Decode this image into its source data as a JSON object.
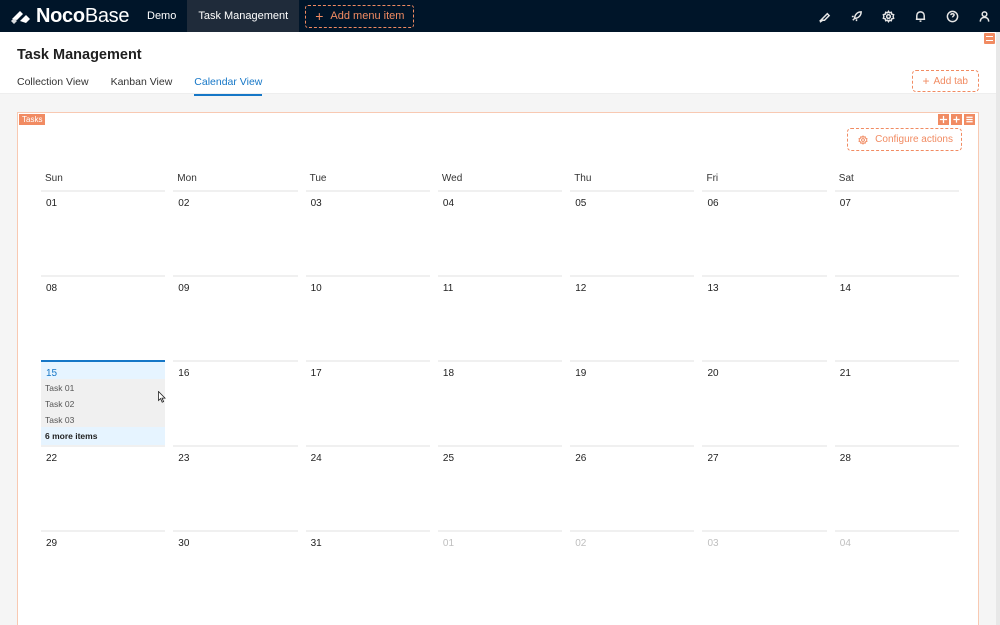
{
  "brand": {
    "bold": "Noco",
    "light": "Base"
  },
  "nav": {
    "items": [
      {
        "label": "Demo",
        "active": false
      },
      {
        "label": "Task Management",
        "active": true
      }
    ],
    "add_menu_label": "Add menu item"
  },
  "top_icons": [
    "highlighter-icon",
    "rocket-icon",
    "gear-icon",
    "bell-icon",
    "help-icon",
    "user-icon"
  ],
  "page": {
    "title": "Task Management",
    "tabs": [
      {
        "label": "Collection View",
        "active": false
      },
      {
        "label": "Kanban View",
        "active": false
      },
      {
        "label": "Calendar View",
        "active": true
      }
    ],
    "add_tab_label": "Add tab"
  },
  "block": {
    "tag": "Tasks",
    "configure_label": "Configure actions"
  },
  "calendar": {
    "weekdays": [
      "Sun",
      "Mon",
      "Tue",
      "Wed",
      "Thu",
      "Fri",
      "Sat"
    ],
    "weeks": [
      [
        {
          "d": "01"
        },
        {
          "d": "02"
        },
        {
          "d": "03"
        },
        {
          "d": "04"
        },
        {
          "d": "05"
        },
        {
          "d": "06"
        },
        {
          "d": "07"
        }
      ],
      [
        {
          "d": "08"
        },
        {
          "d": "09"
        },
        {
          "d": "10"
        },
        {
          "d": "11"
        },
        {
          "d": "12"
        },
        {
          "d": "13"
        },
        {
          "d": "14"
        }
      ],
      [
        {
          "d": "15",
          "today": true,
          "events": [
            "Task 01",
            "Task 02",
            "Task 03"
          ],
          "more": "6 more items"
        },
        {
          "d": "16"
        },
        {
          "d": "17"
        },
        {
          "d": "18"
        },
        {
          "d": "19"
        },
        {
          "d": "20"
        },
        {
          "d": "21"
        }
      ],
      [
        {
          "d": "22"
        },
        {
          "d": "23"
        },
        {
          "d": "24"
        },
        {
          "d": "25"
        },
        {
          "d": "26"
        },
        {
          "d": "27"
        },
        {
          "d": "28"
        }
      ],
      [
        {
          "d": "29"
        },
        {
          "d": "30"
        },
        {
          "d": "31"
        },
        {
          "d": "01",
          "other": true
        },
        {
          "d": "02",
          "other": true
        },
        {
          "d": "03",
          "other": true
        },
        {
          "d": "04",
          "other": true
        }
      ]
    ]
  },
  "colors": {
    "header_bg": "#001529",
    "accent": "#f18b62",
    "primary": "#1677c7"
  }
}
